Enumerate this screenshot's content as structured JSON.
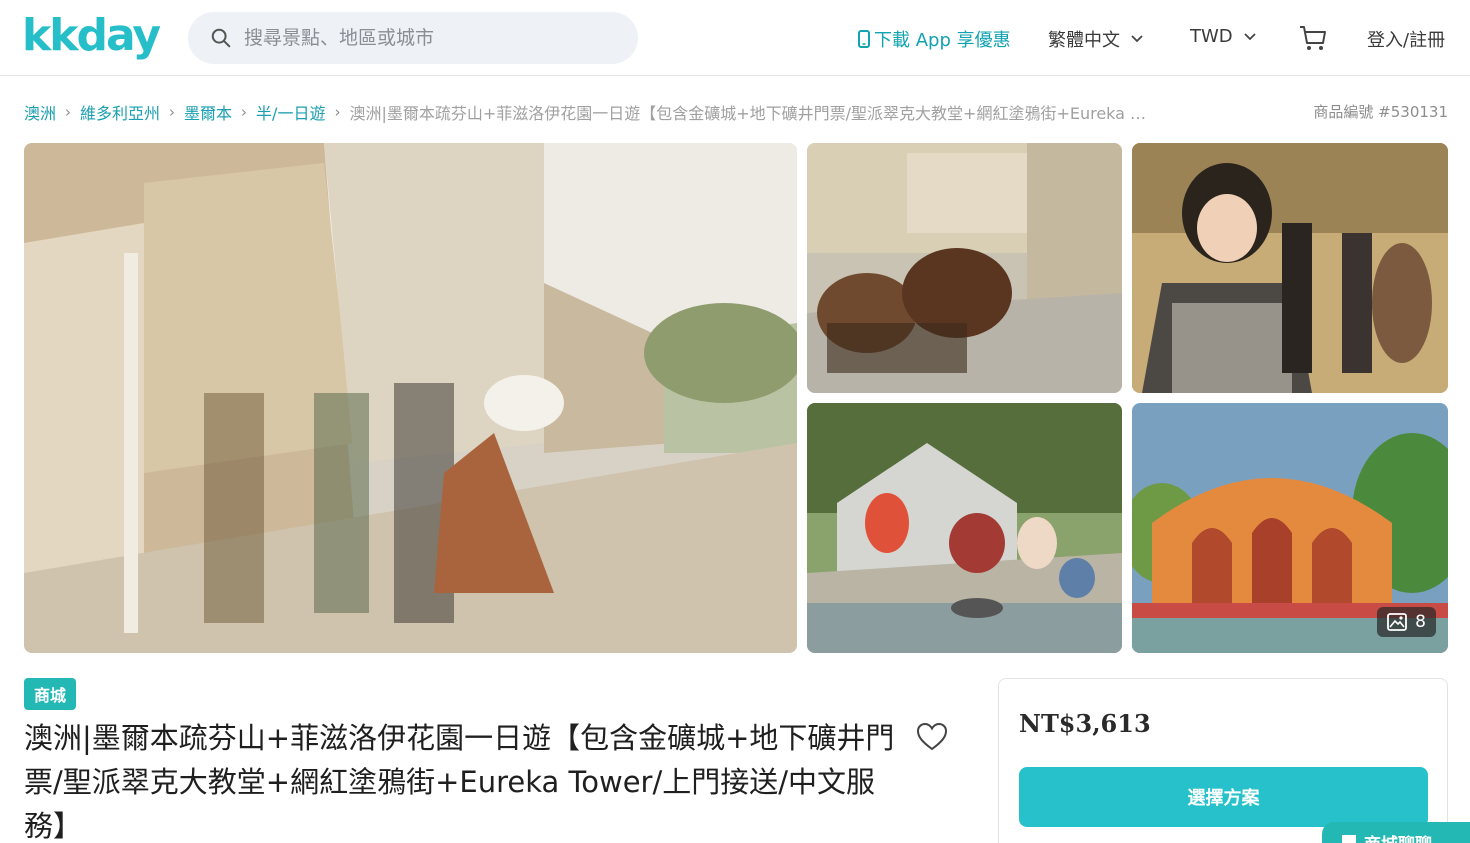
{
  "header": {
    "logo": "kkday",
    "search_placeholder": "搜尋景點、地區或城市",
    "download_app": "下載 App 享優惠",
    "language": "繁體中文",
    "currency": "TWD",
    "login": "登入/註冊"
  },
  "breadcrumb": {
    "items": [
      "澳洲",
      "維多利亞州",
      "墨爾本",
      "半/一日遊"
    ],
    "current": "澳洲|墨爾本疏芬山+菲滋洛伊花園一日遊【包含金礦城+地下礦井門票/聖派翠克大教堂+網紅塗鴉街+Eureka …",
    "product_code": "商品編號 #530131"
  },
  "gallery": {
    "photo_count": "8"
  },
  "product": {
    "badge": "商城",
    "title": "澳洲|墨爾本疏芬山+菲滋洛伊花園一日遊【包含金礦城+地下礦井門票/聖派翠克大教堂+網紅塗鴉街+Eureka Tower/上門接送/中文服務】"
  },
  "price_card": {
    "price": "NT$3,613",
    "select_label": "選擇方案"
  },
  "chat": {
    "label": "商城聊聊"
  },
  "colors": {
    "brand": "#26bec9",
    "link": "#1a9fb0",
    "button": "#27c1cb",
    "badge": "#23b8b4"
  }
}
